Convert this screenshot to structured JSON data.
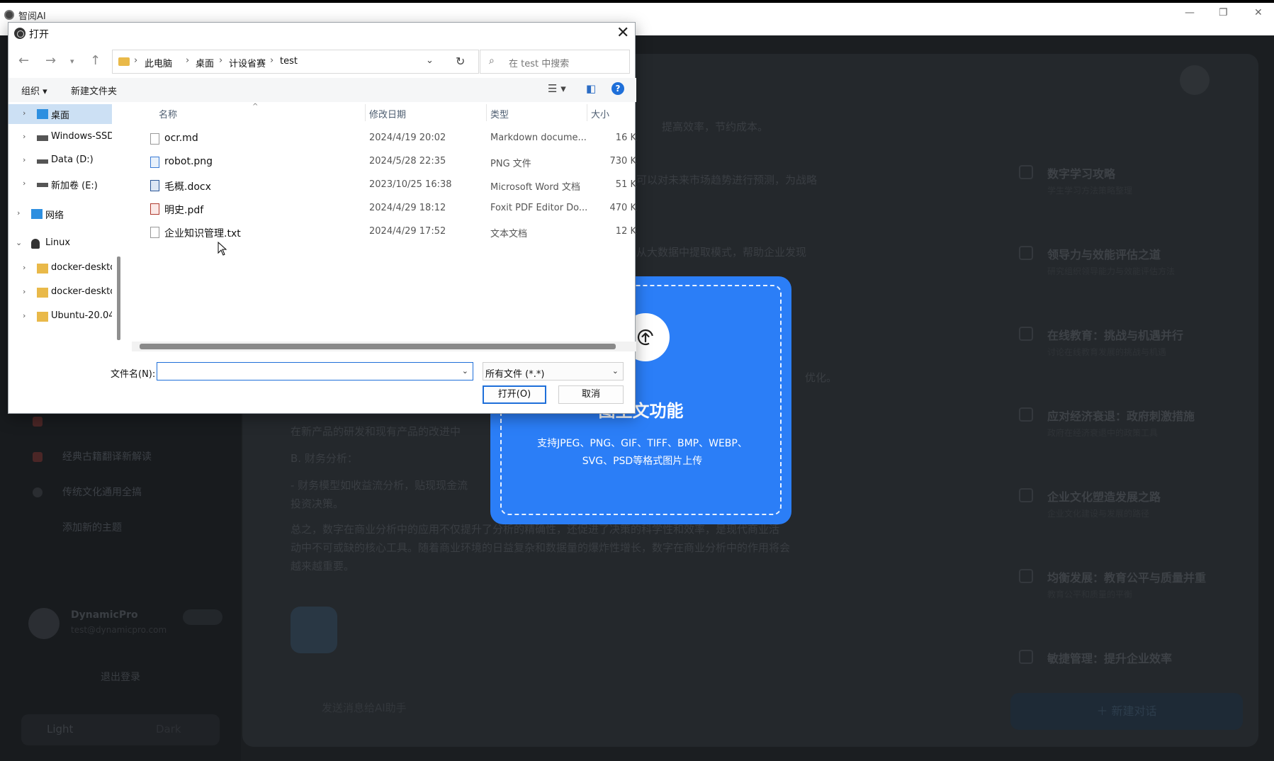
{
  "app": {
    "title": "智阅AI",
    "window_controls": [
      "—",
      "❐",
      "✕"
    ]
  },
  "background": {
    "sidebar_items": [
      {
        "label": ""
      },
      {
        "label": "经典古籍翻译新解读",
        "color": "#4a2626"
      },
      {
        "label": "传统文化通用全搞",
        "color": "#4a2626"
      },
      {
        "label": "添加新的主题",
        "color": "#2a2d31"
      }
    ],
    "user": {
      "name": "DynamicPro",
      "email": "test@dynamicpro.com"
    },
    "logout_label": "退出登录",
    "theme": {
      "light": "Light",
      "dark": "Dark"
    },
    "chat_lines": [
      "提高效率，节约成本。",
      "可以对未来市场趋势进行预测，为战略",
      "从大数据中提取模式，帮助企业发现",
      "优化。",
      "在新产品的研发和现有产品的改进中",
      "B. 财务分析：",
      "- 财务模型如收益流分析，贴现现金流",
      "投资决策。",
      "总之，数字在商业分析中的应用不仅提升了分析的精确性，还促进了决策的科学性和效率，是现代商业活",
      "动中不可或缺的核心工具。随着商业环境的日益复杂和数据量的爆炸性增长，数字在商业分析中的作用将会",
      "越来越重要。"
    ],
    "chat_input_placeholder": "发送消息给AI助手",
    "right_list": [
      {
        "title": "数字学习攻略",
        "sub": "学生学习方法策略整理"
      },
      {
        "title": "领导力与效能评估之道",
        "sub": "研究组织领导能力与效能评估方法"
      },
      {
        "title": "在线教育：挑战与机遇并行",
        "sub": "讨论在线教育发展的挑战与机遇"
      },
      {
        "title": "应对经济衰退：政府刺激措施",
        "sub": "政府在经济衰退中的政策工具"
      },
      {
        "title": "企业文化塑造发展之路",
        "sub": "企业文化建设与发展的路径"
      },
      {
        "title": "均衡发展：教育公平与质量并重",
        "sub": "教育公平和质量的平衡"
      },
      {
        "title": "敏捷管理：提升企业效率",
        "sub": ""
      }
    ],
    "new_chat_label": "＋ 新建对话"
  },
  "upload_card": {
    "title": "图生文功能",
    "description": "支持JPEG、PNG、GIF、TIFF、BMP、WEBP、SVG、PSD等格式图片上传"
  },
  "dialog": {
    "title": "打开",
    "breadcrumbs": [
      "此电脑",
      "桌面",
      "计设省赛",
      "test"
    ],
    "search_placeholder": "在 test 中搜索",
    "toolbar": {
      "organize": "组织 ▾",
      "new_folder": "新建文件夹"
    },
    "nav_tree": [
      {
        "label": "桌面",
        "selected": true,
        "indent": 1,
        "icon": "desktop-icon",
        "icon_color": "#2d8fe0"
      },
      {
        "label": "Windows-SSD",
        "indent": 1,
        "icon": "drive-icon",
        "icon_color": "#555"
      },
      {
        "label": "Data (D:)",
        "indent": 1,
        "icon": "drive-icon",
        "icon_color": "#555"
      },
      {
        "label": "新加卷 (E:)",
        "indent": 1,
        "icon": "drive-icon",
        "icon_color": "#555"
      },
      {
        "label": "网络",
        "indent": 0,
        "icon": "network-icon",
        "icon_color": "#2d8fe0"
      },
      {
        "label": "Linux",
        "indent": 0,
        "expanded": true,
        "icon": "linux-icon",
        "icon_color": "#333"
      },
      {
        "label": "docker-deskto",
        "indent": 1,
        "icon": "folder-icon",
        "icon_color": "#e9b949"
      },
      {
        "label": "docker-deskto",
        "indent": 1,
        "icon": "folder-icon",
        "icon_color": "#e9b949"
      },
      {
        "label": "Ubuntu-20.04",
        "indent": 1,
        "icon": "folder-icon",
        "icon_color": "#e9b949"
      }
    ],
    "columns": {
      "name": "名称",
      "date": "修改日期",
      "type": "类型",
      "size": "大小"
    },
    "files": [
      {
        "name": "ocr.md",
        "date": "2024/4/19 20:02",
        "type": "Markdown docume...",
        "size": "16 K",
        "icon": "file-icon"
      },
      {
        "name": "robot.png",
        "date": "2024/5/28 22:35",
        "type": "PNG 文件",
        "size": "730 K",
        "icon": "png-file-icon"
      },
      {
        "name": "毛概.docx",
        "date": "2023/10/25 16:38",
        "type": "Microsoft Word 文档",
        "size": "51 K",
        "icon": "word-file-icon"
      },
      {
        "name": "明史.pdf",
        "date": "2024/4/29 18:12",
        "type": "Foxit PDF Editor Do...",
        "size": "470 K",
        "icon": "pdf-file-icon"
      },
      {
        "name": "企业知识管理.txt",
        "date": "2024/4/29 17:52",
        "type": "文本文档",
        "size": "12 K",
        "icon": "text-file-icon"
      }
    ],
    "filename_label": "文件名(N):",
    "filename_value": "",
    "filter_value": "所有文件 (*.*)",
    "open_label": "打开(O)",
    "cancel_label": "取消"
  }
}
